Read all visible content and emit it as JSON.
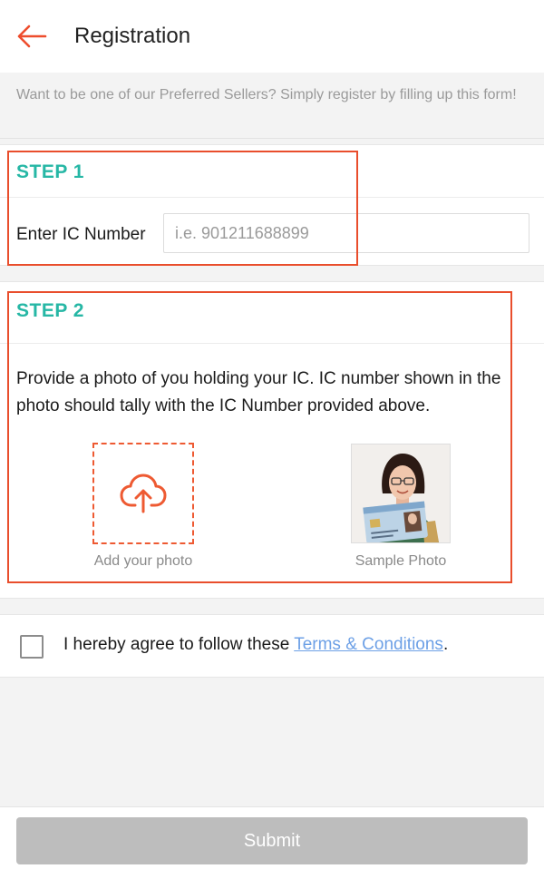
{
  "header": {
    "title": "Registration",
    "back_icon": "arrow-left-icon"
  },
  "notice": {
    "text": "Want to be one of our Preferred Sellers? Simply register by filling up this form!"
  },
  "step1": {
    "title": "STEP 1",
    "ic_label": "Enter IC Number",
    "ic_value": "",
    "ic_placeholder": "i.e. 901211688899"
  },
  "step2": {
    "title": "STEP 2",
    "description": "Provide a photo of you holding your IC. IC number shown in the photo should tally with the IC Number provided above.",
    "upload_label": "Add your photo",
    "upload_icon": "cloud-upload-icon",
    "sample_label": "Sample Photo"
  },
  "agreement": {
    "checked": false,
    "text_before": "I hereby agree to follow these ",
    "link_text": "Terms & Conditions",
    "text_after": "."
  },
  "footer": {
    "submit_label": "Submit"
  },
  "colors": {
    "accent": "#ee4d2d",
    "step_title": "#26b7a5",
    "link": "#6da0e6",
    "submit_disabled": "#bdbdbd",
    "highlight_border": "#e94e2c"
  }
}
